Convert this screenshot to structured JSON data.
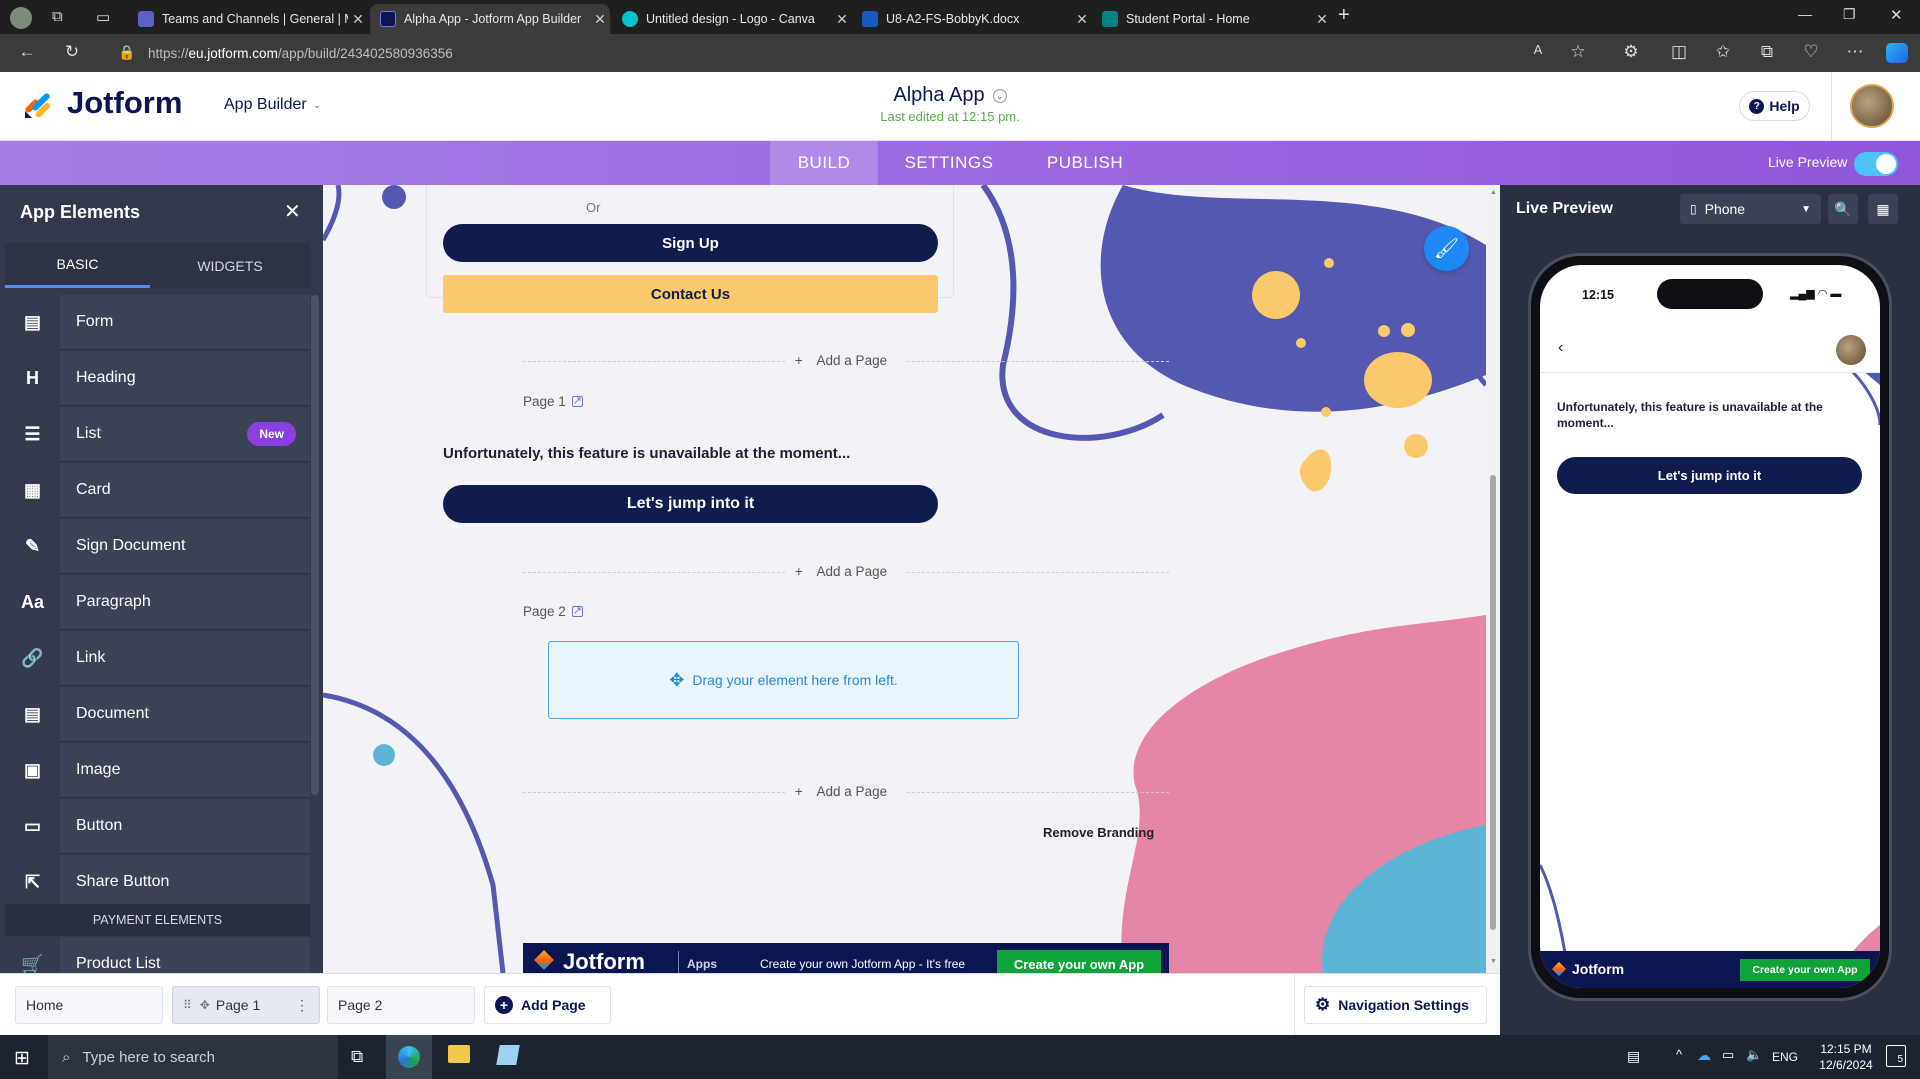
{
  "browser": {
    "tabs": [
      {
        "title": "Teams and Channels | General | M",
        "favicon_color": "#5b5fc7"
      },
      {
        "title": "Alpha App - Jotform App Builder",
        "favicon_color": "#0a1551"
      },
      {
        "title": "Untitled design - Logo - Canva",
        "favicon_color": "#00c4cc"
      },
      {
        "title": "U8-A2-FS-BobbyK.docx",
        "favicon_color": "#185abd"
      },
      {
        "title": "Student Portal - Home",
        "favicon_color": "#038387"
      }
    ],
    "url_prefix": "https://",
    "url_host": "eu.jotform.com",
    "url_path": "/app/build/243402580936356"
  },
  "header": {
    "logo_text": "Jotform",
    "app_builder_label": "App Builder",
    "app_name": "Alpha App",
    "last_edited": "Last edited at 12:15 pm.",
    "help_label": "Help"
  },
  "builder_tabs": {
    "build": "BUILD",
    "settings": "SETTINGS",
    "publish": "PUBLISH",
    "live_preview_label": "Live Preview"
  },
  "sidebar": {
    "title": "App Elements",
    "tab_basic": "BASIC",
    "tab_widgets": "WIDGETS",
    "items": [
      {
        "label": "Form",
        "icon": "form-icon"
      },
      {
        "label": "Heading",
        "icon": "heading-icon"
      },
      {
        "label": "List",
        "icon": "list-icon",
        "badge": "New"
      },
      {
        "label": "Card",
        "icon": "card-icon"
      },
      {
        "label": "Sign Document",
        "icon": "sign-document-icon"
      },
      {
        "label": "Paragraph",
        "icon": "paragraph-icon"
      },
      {
        "label": "Link",
        "icon": "link-icon"
      },
      {
        "label": "Document",
        "icon": "document-icon"
      },
      {
        "label": "Image",
        "icon": "image-icon"
      },
      {
        "label": "Button",
        "icon": "button-icon"
      },
      {
        "label": "Share Button",
        "icon": "share-icon"
      }
    ],
    "icon_glyphs": [
      "▤",
      "H",
      "☰",
      "▦",
      "✎",
      "Aa",
      "🔗",
      "▤",
      "▣",
      "▭",
      "⇱"
    ],
    "payment_section": "PAYMENT ELEMENTS",
    "product_list": "Product List"
  },
  "canvas": {
    "or_text": "Or",
    "sign_up": "Sign Up",
    "contact_us": "Contact Us",
    "add_page": "Add a Page",
    "page1_label": "Page 1",
    "unavailable_text": "Unfortunately, this feature is unavailable at the moment...",
    "jump_button": "Let's jump into it",
    "page2_label": "Page 2",
    "drag_text": "Drag your element here from left.",
    "remove_branding": "Remove Branding",
    "footer_logo": "Jotform",
    "footer_apps": "Apps",
    "footer_promo": "Create your own Jotform App - It's free",
    "footer_cta": "Create your own App"
  },
  "preview": {
    "title": "Live Preview",
    "device": "Phone",
    "phone_time": "12:15",
    "message": "Unfortunately, this feature is unavailable at the moment...",
    "button": "Let's jump into it",
    "footer_logo": "Jotform",
    "footer_cta": "Create your own App"
  },
  "pagebar": {
    "home": "Home",
    "page1": "Page 1",
    "page2": "Page 2",
    "add_page": "Add Page",
    "nav_settings": "Navigation Settings"
  },
  "taskbar": {
    "search_placeholder": "Type here to search",
    "lang": "ENG",
    "time": "12:15 PM",
    "date": "12/6/2024",
    "notifications": "5"
  },
  "colors": {
    "navy": "#111c4e",
    "purple": "#9c6be0",
    "yellow": "#f9c96b",
    "blob_blue": "#5458b0",
    "blob_pink": "#e686a6",
    "blob_cyan": "#5cb5d6",
    "jotform_green": "#0fa33a"
  }
}
